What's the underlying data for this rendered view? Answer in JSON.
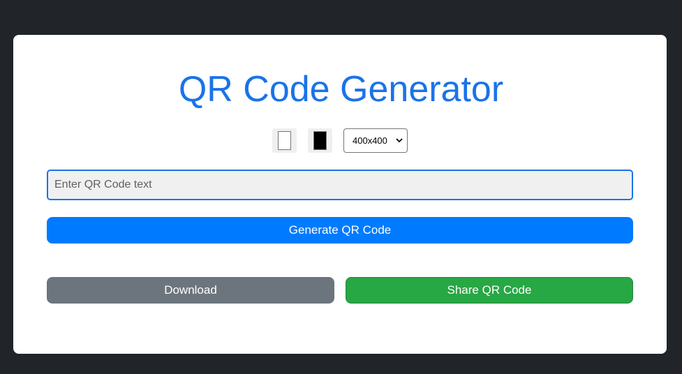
{
  "title": "QR Code Generator",
  "controls": {
    "background_color": "#ffffff",
    "foreground_color": "#000000",
    "size_selected": "400x400"
  },
  "input": {
    "placeholder": "Enter QR Code text",
    "value": ""
  },
  "buttons": {
    "generate": "Generate QR Code",
    "download": "Download",
    "share": "Share QR Code"
  },
  "colors": {
    "page_background": "#212529",
    "title": "#1a73e8",
    "generate": "#007bff",
    "download": "#6c757d",
    "share": "#28a745"
  }
}
